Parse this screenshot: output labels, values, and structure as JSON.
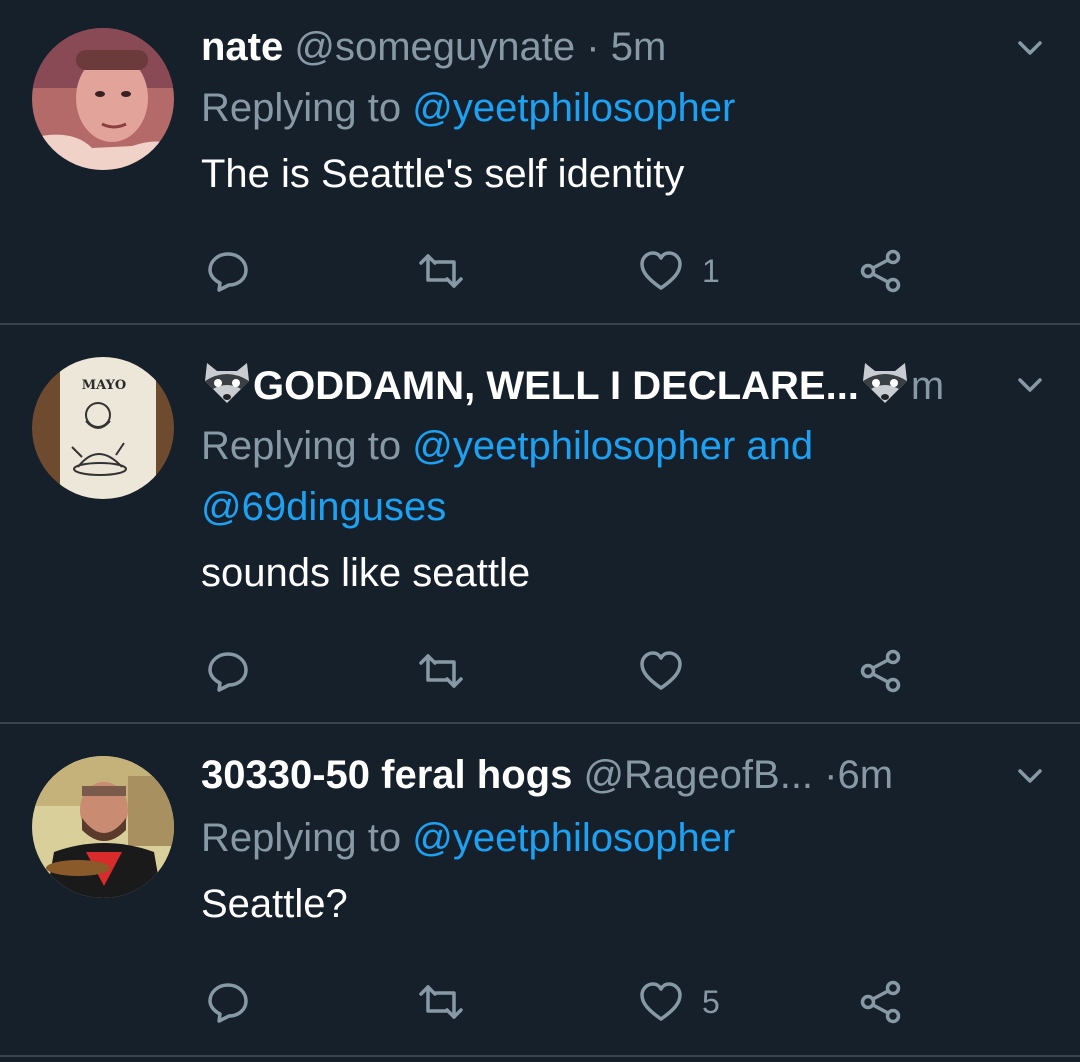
{
  "tweets": [
    {
      "name": "nate",
      "handle": "@someguynate",
      "dot": "·",
      "time": "5m",
      "replying_prefix": "Replying to ",
      "mentions_line1": "@yeetphilosopher",
      "mentions_line2": "",
      "text": "The is Seattle's self identity",
      "likes": "1"
    },
    {
      "name": "GODDAMN, WELL I DECLARE...",
      "handle": "",
      "dot": "",
      "time": "m",
      "replying_prefix": "Replying to ",
      "mentions_line1": "@yeetphilosopher and",
      "mentions_line2": "@69dinguses",
      "text": "sounds like seattle",
      "likes": ""
    },
    {
      "name": "30330-50 feral hogs",
      "handle": "@RageofB...",
      "dot": "·",
      "time": "6m",
      "replying_prefix": "Replying to ",
      "mentions_line1": "@yeetphilosopher",
      "mentions_line2": "",
      "text": "Seattle?",
      "likes": "5"
    }
  ],
  "avatar_labels": {
    "mayo": "MAYO"
  },
  "colors": {
    "background": "#15202b",
    "divider": "#38444d",
    "secondary_text": "#8899a6",
    "link": "#1da1f2"
  }
}
